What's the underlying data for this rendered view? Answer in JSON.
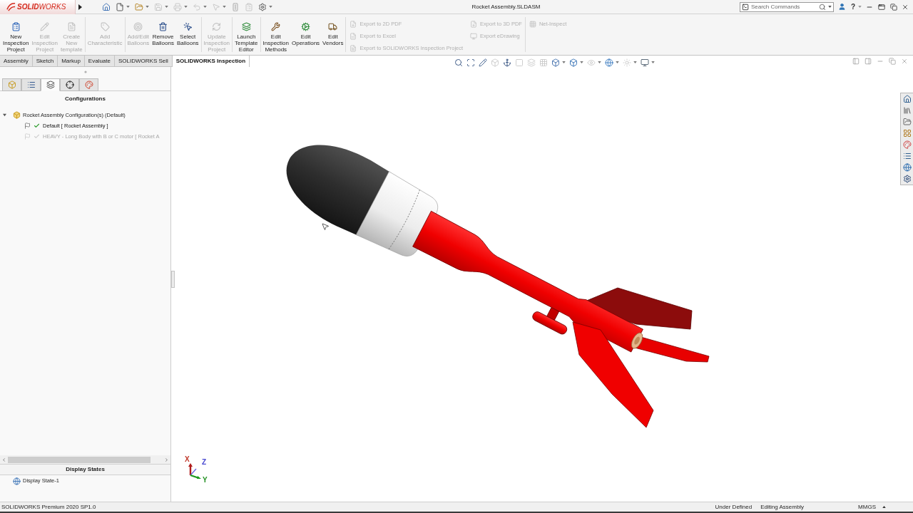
{
  "window": {
    "logo_text": "**SOLID**WORKS",
    "title": "Rocket Assembly.SLDASM",
    "help_label": "?"
  },
  "quick_access": [
    {
      "disabled": false,
      "dropdown": false
    },
    {
      "disabled": false,
      "dropdown": true
    },
    {
      "disabled": false,
      "dropdown": true
    },
    {
      "disabled": true,
      "dropdown": true
    },
    {
      "disabled": true,
      "dropdown": true
    },
    {
      "disabled": true,
      "dropdown": true
    },
    {
      "disabled": true,
      "dropdown": true
    },
    {
      "disabled": true,
      "dropdown": false
    },
    {
      "disabled": true,
      "dropdown": false
    },
    {
      "disabled": false,
      "dropdown": true
    }
  ],
  "search": {
    "placeholder": "Search Commands"
  },
  "ribbon": {
    "groups": [
      {
        "buttons": [
          {
            "label": "New Inspection Project",
            "disabled": false
          },
          {
            "label": "Edit Inspection Project",
            "disabled": true
          },
          {
            "label": "Create New template",
            "disabled": true
          }
        ]
      },
      {
        "buttons": [
          {
            "label": "Add Characteristic",
            "disabled": true
          }
        ]
      },
      {
        "buttons": [
          {
            "label": "Add/Edit Balloons",
            "disabled": true
          },
          {
            "label": "Remove Balloons",
            "disabled": false
          },
          {
            "label": "Select Balloons",
            "disabled": false
          }
        ]
      },
      {
        "buttons": [
          {
            "label": "Update Inspection Project",
            "disabled": true
          }
        ]
      },
      {
        "buttons": [
          {
            "label": "Launch Template Editor",
            "disabled": false
          }
        ]
      },
      {
        "buttons": [
          {
            "label": "Edit Inspection Methods",
            "disabled": false
          },
          {
            "label": "Edit Operations",
            "disabled": false
          },
          {
            "label": "Edit Vendors",
            "disabled": false
          }
        ]
      }
    ],
    "export_columns": [
      {
        "items": [
          {
            "label": "Export to 2D PDF",
            "disabled": true
          },
          {
            "label": "Export to Excel",
            "disabled": true
          },
          {
            "label": "Export to SOLIDWORKS Inspection Project",
            "disabled": true
          }
        ]
      },
      {
        "items": [
          {
            "label": "Export to 3D PDF",
            "disabled": true
          },
          {
            "label": "Export eDrawing",
            "disabled": true
          }
        ]
      }
    ],
    "net_inspect": {
      "label": "Net-Inspect",
      "disabled": true
    }
  },
  "tabs": [
    {
      "label": "Assembly",
      "selected": false
    },
    {
      "label": "Sketch",
      "selected": false
    },
    {
      "label": "Markup",
      "selected": false
    },
    {
      "label": "Evaluate",
      "selected": false
    },
    {
      "label": "SOLIDWORKS Sell",
      "selected": false
    },
    {
      "label": "SOLIDWORKS Inspection",
      "selected": true
    }
  ],
  "view_toolbar": [
    {
      "disabled": false,
      "dropdown": false
    },
    {
      "disabled": false,
      "dropdown": false
    },
    {
      "disabled": false,
      "dropdown": false
    },
    {
      "disabled": true,
      "dropdown": false
    },
    {
      "disabled": false,
      "dropdown": false
    },
    {
      "disabled": true,
      "dropdown": false
    },
    {
      "disabled": true,
      "dropdown": false
    },
    {
      "disabled": true,
      "dropdown": false
    },
    {
      "disabled": false,
      "dropdown": true
    },
    {
      "disabled": false,
      "dropdown": true
    },
    {
      "disabled": true,
      "dropdown": true
    },
    {
      "disabled": false,
      "dropdown": true
    },
    {
      "disabled": true,
      "dropdown": true
    },
    {
      "disabled": false,
      "dropdown": true
    }
  ],
  "panel_tabs": [
    {
      "selected": false
    },
    {
      "selected": false
    },
    {
      "selected": true
    },
    {
      "selected": false
    },
    {
      "selected": false
    }
  ],
  "configurations": {
    "title": "Configurations",
    "tree": [
      {
        "label": "Rocket Assembly Configuration(s) (Default)",
        "expanded": true,
        "children": [
          {
            "label": "Default [ Rocket Assembly ]",
            "active": true
          },
          {
            "label": "HEAVY - Long Body with B or C motor [ Rocket A",
            "active": false
          }
        ]
      }
    ]
  },
  "display_states": {
    "title": "Display States",
    "items": [
      {
        "label": "Display State-1"
      }
    ]
  },
  "triad": {
    "axes": [
      {
        "label": "X",
        "color": "#c0392b"
      },
      {
        "label": "Z",
        "color": "#4a4ad0"
      },
      {
        "label": "Y",
        "color": "#1f8f1f"
      }
    ]
  },
  "status_bar": {
    "product": "SOLIDWORKS Premium 2020 SP1.0",
    "items": [
      "Under Defined",
      "Editing Assembly",
      "MMGS"
    ]
  }
}
